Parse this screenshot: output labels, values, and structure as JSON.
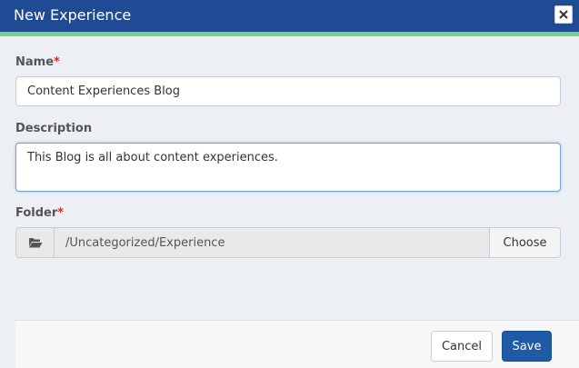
{
  "dialog": {
    "title": "New Experience",
    "close_icon": "close-icon",
    "colors": {
      "header": "#1f4b94",
      "accent": "#7dd184",
      "primary_button": "#1f5aa6"
    }
  },
  "fields": {
    "name": {
      "label": "Name",
      "required_marker": "*",
      "value": "Content Experiences Blog"
    },
    "description": {
      "label": "Description",
      "value": "This Blog is all about content experiences."
    },
    "folder": {
      "label": "Folder",
      "required_marker": "*",
      "icon": "folder-open-icon",
      "path": "/Uncategorized/Experience",
      "choose_label": "Choose"
    }
  },
  "footer": {
    "cancel_label": "Cancel",
    "save_label": "Save"
  }
}
